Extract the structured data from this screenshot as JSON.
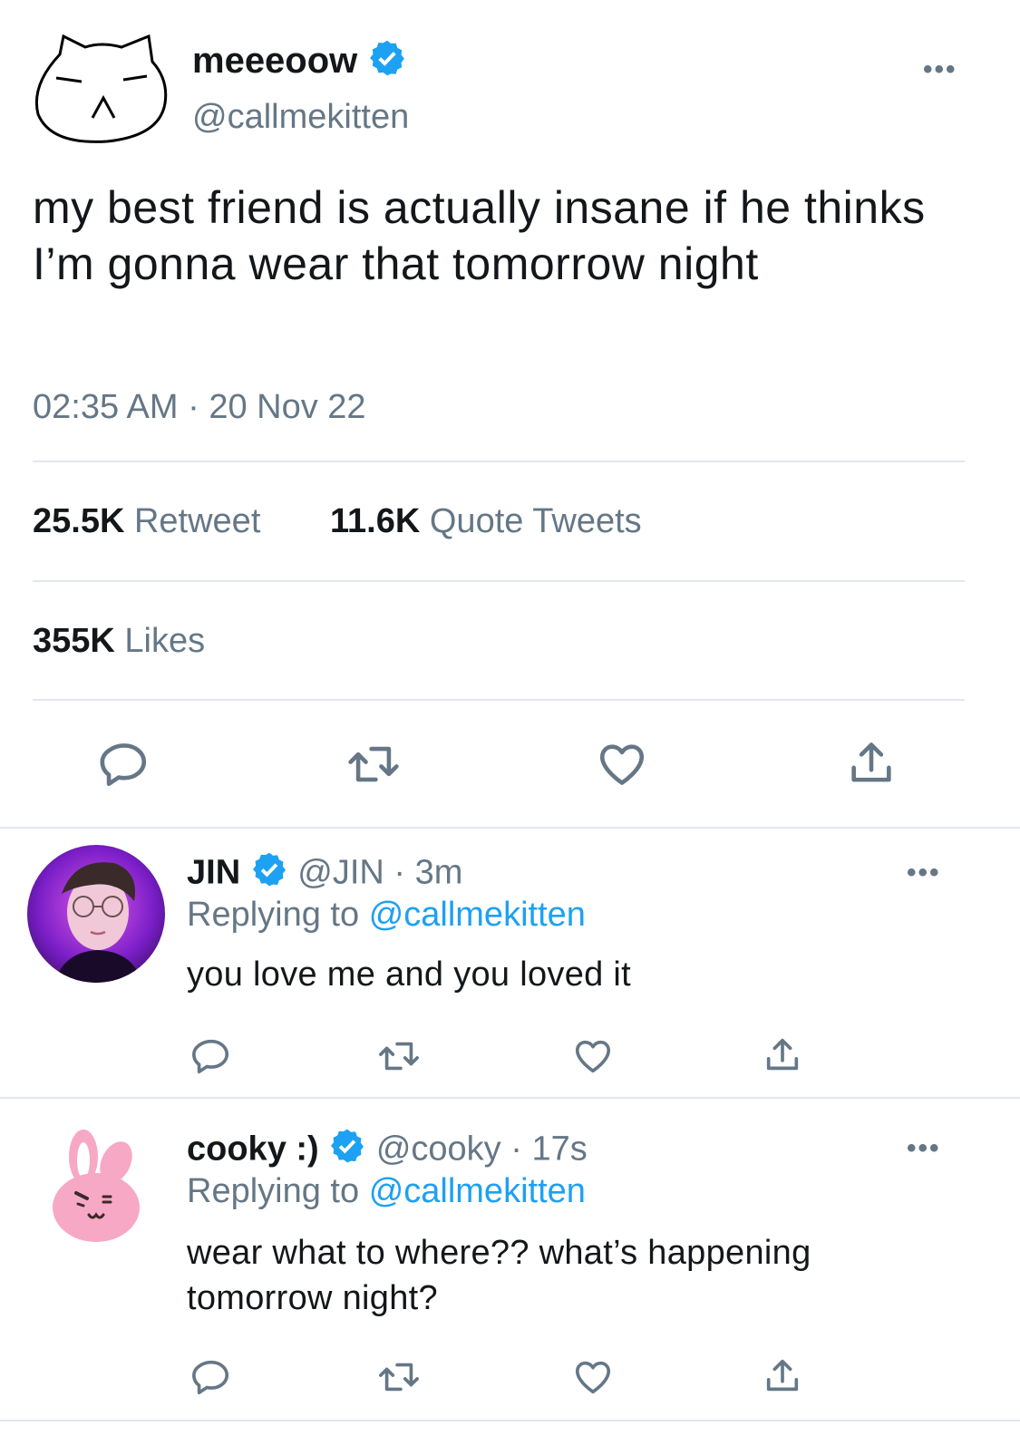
{
  "main_tweet": {
    "display_name": "meeeoow",
    "handle": "@callmekitten",
    "text": "my best friend is actually insane if he thinks I’m gonna wear that tomorrow night",
    "time": "02:35 AM",
    "separator": "·",
    "date": "20 Nov 22",
    "retweet_count": "25.5K",
    "retweet_label": "Retweet",
    "quote_count": "11.6K",
    "quote_label": "Quote Tweets",
    "likes_count": "355K",
    "likes_label": "Likes",
    "more_icon": "more-horizontal-icon"
  },
  "replies": [
    {
      "display_name": "JIN",
      "handle": "@JIN",
      "separator": "·",
      "time": "3m",
      "replying_label": "Replying to",
      "replying_handle": "@callmekitten",
      "text": "you love me and you loved it"
    },
    {
      "display_name": "cooky :)",
      "handle": "@cooky",
      "separator": "·",
      "time": "17s",
      "replying_label": "Replying to",
      "replying_handle": "@callmekitten",
      "text": "wear what to where?? what’s happening tomorrow night?"
    }
  ],
  "actions": [
    "reply-icon",
    "retweet-icon",
    "like-icon",
    "share-icon"
  ],
  "colors": {
    "accent": "#1da1f2",
    "muted_text": "#657786",
    "divider": "#e1e8ed",
    "cooky_pink": "#f7a8c4"
  }
}
